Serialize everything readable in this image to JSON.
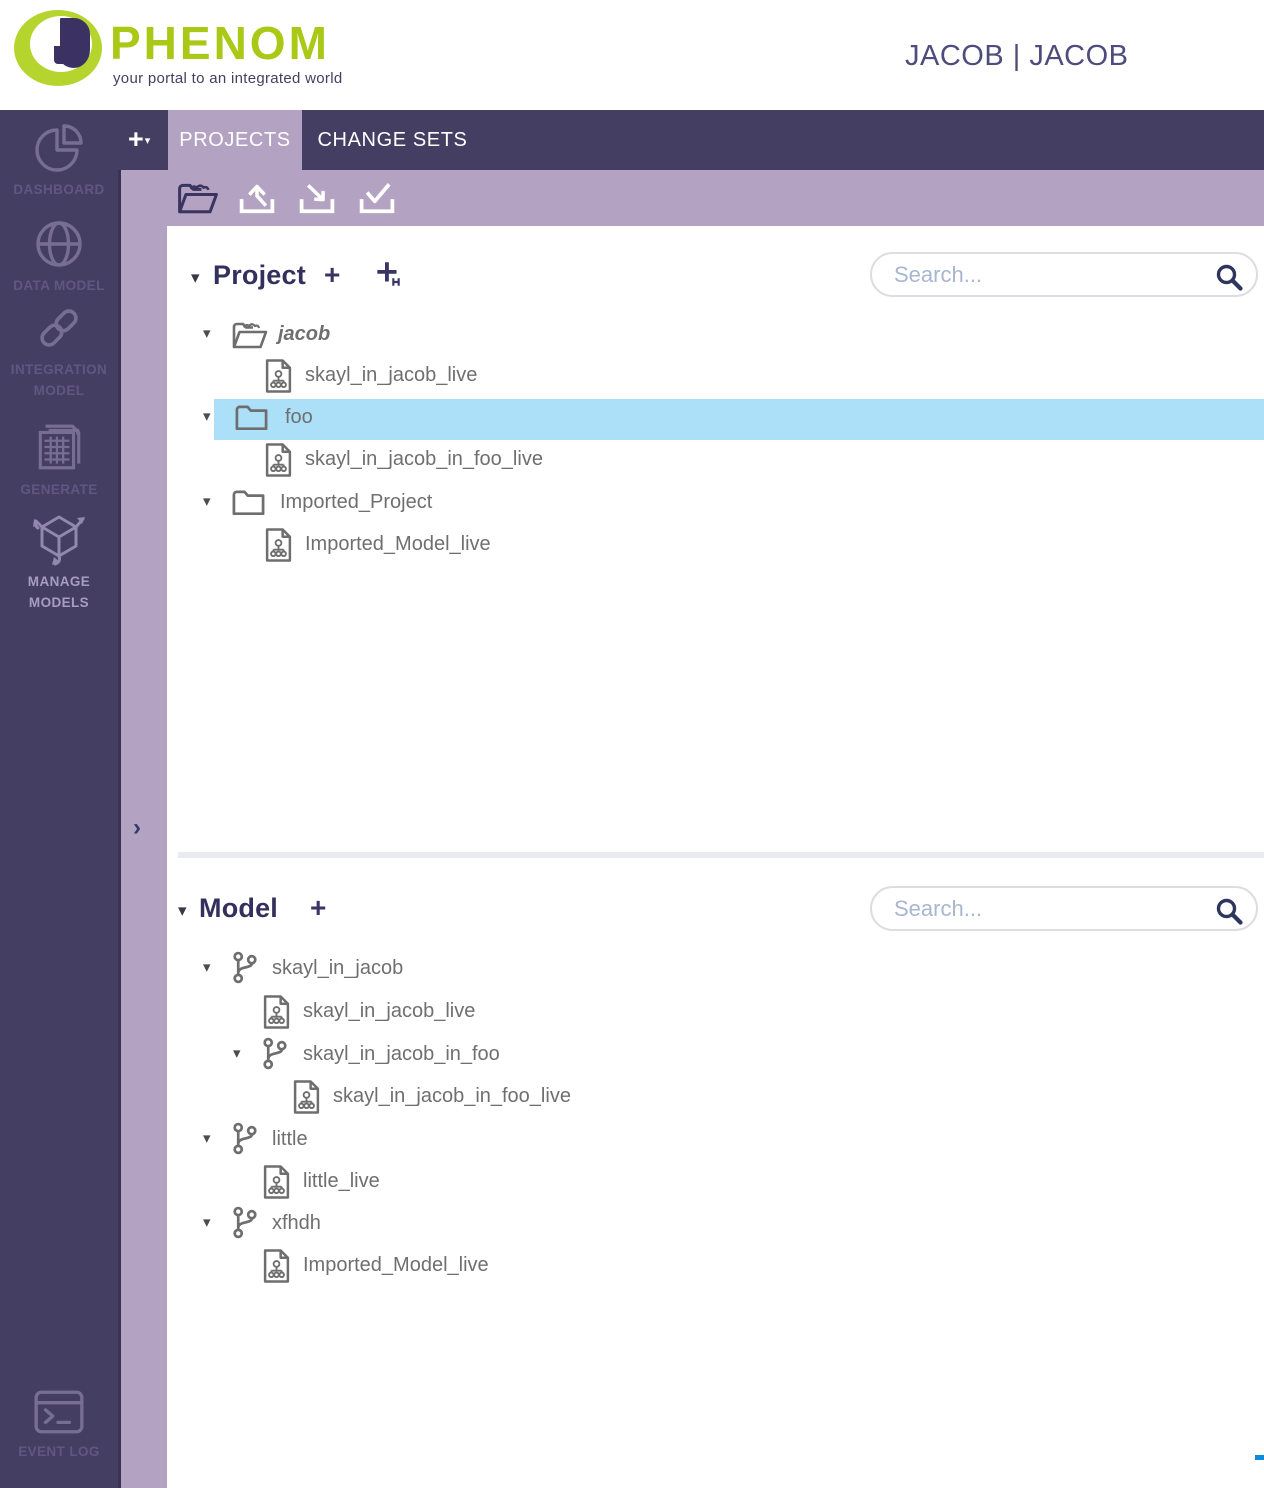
{
  "header": {
    "brand": "PHENOM",
    "tagline": "your portal to an integrated world",
    "user": "JACOB | JACOB"
  },
  "glyphs": {
    "caret_down": "▾",
    "chevron_right": "›",
    "plus": "+",
    "dropdown_arrow": "▾"
  },
  "sidebar": {
    "items": [
      {
        "label": "DASHBOARD",
        "icon": "pie-chart-icon",
        "active": false
      },
      {
        "label": "DATA MODEL",
        "icon": "globe-icon",
        "active": false
      },
      {
        "label1": "INTEGRATION",
        "label2": "MODEL",
        "icon": "link-icon",
        "active": false
      },
      {
        "label": "GENERATE",
        "icon": "spreadsheet-icon",
        "active": false
      },
      {
        "label1": "MANAGE",
        "label2": "MODELS",
        "icon": "cube-icon",
        "active": true
      },
      {
        "label": "EVENT LOG",
        "icon": "terminal-icon",
        "active": false
      }
    ]
  },
  "tabs": {
    "add_button": "+",
    "items": [
      {
        "label": "PROJECTS",
        "active": true
      },
      {
        "label": "CHANGE SETS",
        "active": false
      }
    ]
  },
  "toolbar": {
    "buttons": [
      {
        "name": "open-project",
        "icon": "folder-open-icon"
      },
      {
        "name": "import",
        "icon": "upload-tray-icon"
      },
      {
        "name": "export",
        "icon": "download-tray-icon"
      },
      {
        "name": "commit",
        "icon": "check-tray-icon"
      }
    ]
  },
  "project_panel": {
    "title": "Project",
    "add_label": "+",
    "add_folder_label": "+",
    "search": {
      "placeholder": "Search...",
      "value": ""
    },
    "tree": [
      {
        "label": "jacob",
        "type": "project-open",
        "level": 1,
        "selected": false
      },
      {
        "label": "skayl_in_jacob_live",
        "type": "model-doc",
        "level": 2,
        "selected": false
      },
      {
        "label": "foo",
        "type": "folder",
        "level": 1,
        "selected": true
      },
      {
        "label": "skayl_in_jacob_in_foo_live",
        "type": "model-doc",
        "level": 2,
        "selected": false
      },
      {
        "label": "Imported_Project",
        "type": "folder",
        "level": 1,
        "selected": false
      },
      {
        "label": "Imported_Model_live",
        "type": "model-doc",
        "level": 2,
        "selected": false
      }
    ]
  },
  "model_panel": {
    "title": "Model",
    "add_label": "+",
    "search": {
      "placeholder": "Search...",
      "value": ""
    },
    "tree": [
      {
        "label": "skayl_in_jacob",
        "type": "branch",
        "level": 1
      },
      {
        "label": "skayl_in_jacob_live",
        "type": "model-doc",
        "level": 2
      },
      {
        "label": "skayl_in_jacob_in_foo",
        "type": "branch",
        "level": 2
      },
      {
        "label": "skayl_in_jacob_in_foo_live",
        "type": "model-doc",
        "level": 3
      },
      {
        "label": "little",
        "type": "branch",
        "level": 1
      },
      {
        "label": "little_live",
        "type": "model-doc",
        "level": 2
      },
      {
        "label": "xfhdh",
        "type": "branch",
        "level": 1
      },
      {
        "label": "Imported_Model_live",
        "type": "model-doc",
        "level": 2
      }
    ]
  },
  "colors": {
    "sidebar_bg": "#453e63",
    "panel_mauve": "#b3a2c1",
    "selection_blue": "#ace0f8",
    "brand_green": "#a9c916",
    "logo_navy": "#3b3263",
    "heading_navy": "#34305e",
    "tree_text": "#6f6f6f",
    "cursor_blue": "#0f8bdd"
  }
}
